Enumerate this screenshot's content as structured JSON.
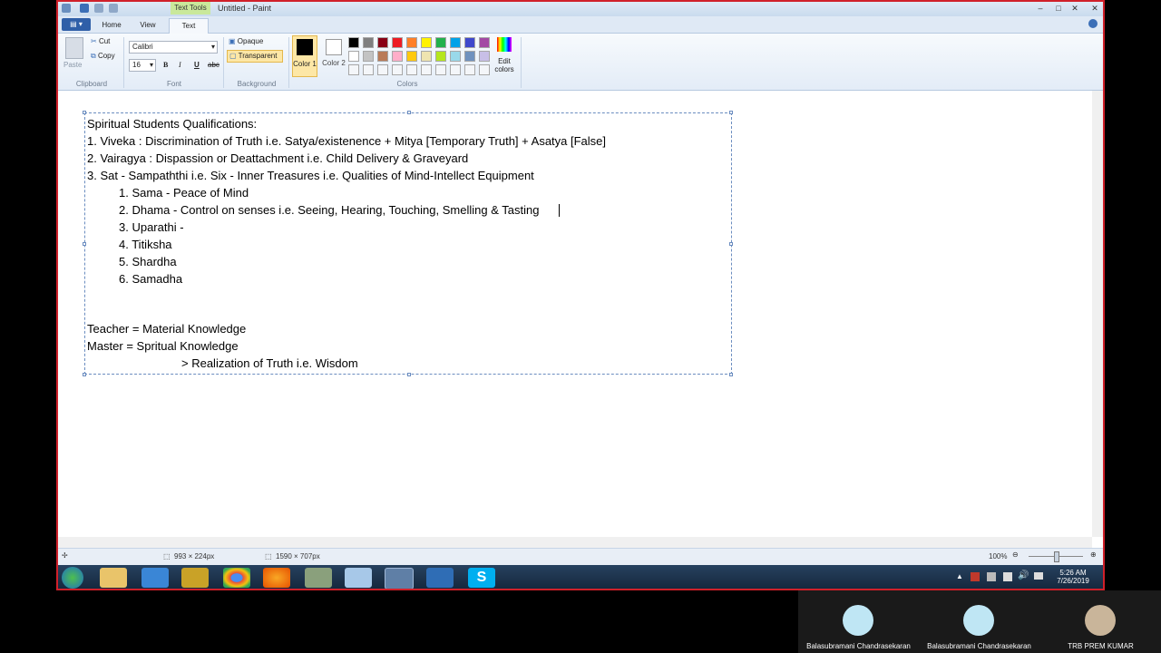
{
  "window": {
    "title": "Untitled - Paint",
    "context_tab": "Text Tools"
  },
  "ribbon": {
    "tabs": [
      "Home",
      "View",
      "Text"
    ],
    "clipboard": {
      "paste": "Paste",
      "cut": "Cut",
      "copy": "Copy",
      "group": "Clipboard"
    },
    "font": {
      "family": "Calibri",
      "size": "16",
      "bold": "B",
      "italic": "I",
      "underline": "U",
      "strike": "abc",
      "group": "Font"
    },
    "background": {
      "opaque": "Opaque",
      "transparent": "Transparent",
      "group": "Background"
    },
    "colors": {
      "color1": "Color 1",
      "color2": "Color 2",
      "edit": "Edit colors",
      "group": "Colors",
      "row1": [
        "#000000",
        "#7f7f7f",
        "#880015",
        "#ed1c24",
        "#ff7f27",
        "#fff200",
        "#22b14c",
        "#00a2e8",
        "#3f48cc",
        "#a349a4"
      ],
      "row2": [
        "#ffffff",
        "#c3c3c3",
        "#b97a57",
        "#ffaec9",
        "#ffc90e",
        "#efe4b0",
        "#b5e61d",
        "#99d9ea",
        "#7092be",
        "#c8bfe7"
      ]
    }
  },
  "canvas_text": {
    "lines": [
      "Spiritual Students Qualifications:",
      "1. Viveka : Discrimination of Truth i.e. Satya/existenence + Mitya [Temporary Truth] + Asatya [False]",
      "2. Vairagya : Dispassion or Deattachment i.e. Child Delivery & Graveyard",
      "3. Sat - Sampaththi i.e. Six - Inner Treasures i.e. Qualities of Mind-Intellect Equipment",
      "1. Sama - Peace of Mind",
      "2. Dhama - Control on senses i.e. Seeing, Hearing, Touching, Smelling & Tasting",
      "3. Uparathi -",
      "4. Titiksha",
      "5. Shardha",
      "6. Samadha",
      "Teacher = Material Knowledge",
      "Master = Spritual Knowledge",
      "> Realization of Truth i.e. Wisdom"
    ]
  },
  "status": {
    "selection_size": "993 × 224px",
    "image_size": "1590 × 707px",
    "zoom": "100%"
  },
  "taskbar": {
    "time": "5:26 AM",
    "date": "7/26/2019"
  },
  "participants": [
    {
      "name": "Balasubramani Chandrasekaran"
    },
    {
      "name": "Balasubramani Chandrasekaran"
    },
    {
      "name": "TRB PREM KUMAR"
    }
  ]
}
